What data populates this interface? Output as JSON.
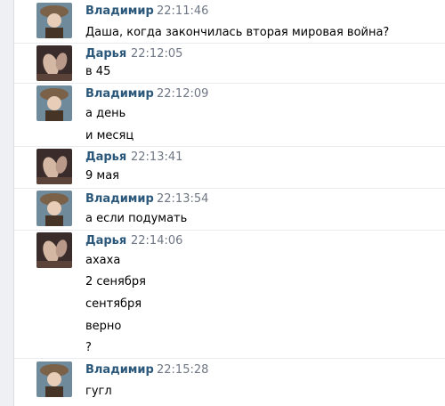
{
  "messages": [
    {
      "author": "Владимир",
      "time": "22:11:46",
      "avatar": "vladimir-avatar",
      "lines": [
        "Даша, когда закончилась вторая мировая война?"
      ]
    },
    {
      "author": "Дарья",
      "time": "22:12:05",
      "avatar": "darya-avatar",
      "lines": [
        "в 45"
      ]
    },
    {
      "author": "Владимир",
      "time": "22:12:09",
      "avatar": "vladimir-avatar",
      "lines": [
        "а день",
        "и месяц"
      ]
    },
    {
      "author": "Дарья",
      "time": "22:13:41",
      "avatar": "darya-avatar",
      "lines": [
        "9 мая"
      ]
    },
    {
      "author": "Владимир",
      "time": "22:13:54",
      "avatar": "vladimir-avatar",
      "lines": [
        "а если подумать"
      ]
    },
    {
      "author": "Дарья",
      "time": "22:14:06",
      "avatar": "darya-avatar",
      "lines": [
        "ахаха",
        "2 сенября",
        "сентября",
        "верно",
        "?"
      ]
    },
    {
      "author": "Владимир",
      "time": "22:15:28",
      "avatar": "vladimir-avatar",
      "lines": [
        "гугл"
      ]
    }
  ],
  "colors": {
    "author": "#2b587a",
    "time": "#6f7784",
    "text": "#000000",
    "separator": "#e9ebee"
  }
}
